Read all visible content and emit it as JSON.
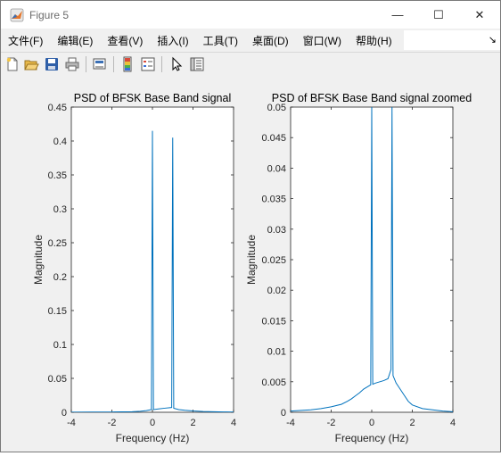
{
  "window": {
    "title": "Figure 5",
    "minimize_glyph": "—",
    "maximize_glyph": "☐",
    "close_glyph": "✕"
  },
  "menu": {
    "items": [
      "文件(F)",
      "编辑(E)",
      "查看(V)",
      "插入(I)",
      "工具(T)",
      "桌面(D)",
      "窗口(W)",
      "帮助(H)"
    ],
    "overflow_glyph": "↘"
  },
  "toolbar": {
    "icons": [
      "new-figure-icon",
      "open-file-icon",
      "save-icon",
      "print-icon",
      "link-plot-icon",
      "insert-colorbar-icon",
      "insert-legend-icon",
      "edit-plot-cursor-icon",
      "property-inspector-icon"
    ]
  },
  "colors": {
    "line": "#0072bd",
    "axes_bg": "#ffffff",
    "figure_bg": "#f0f0f0"
  },
  "chart_data": [
    {
      "type": "line",
      "title": "PSD of BFSK Base Band signal",
      "xlabel": "Frequency (Hz)",
      "ylabel": "Magnitude",
      "xlim": [
        -4,
        4
      ],
      "ylim": [
        0,
        0.45
      ],
      "xticks": [
        "-4",
        "-2",
        "0",
        "2",
        "4"
      ],
      "yticks": [
        "0",
        "0.05",
        "0.1",
        "0.15",
        "0.2",
        "0.25",
        "0.3",
        "0.35",
        "0.4",
        "0.45"
      ],
      "grid": false,
      "series": [
        {
          "x": [
            -4,
            -3,
            -2,
            -1.5,
            -1,
            -0.6,
            -0.3,
            -0.05,
            0,
            0.05,
            0.3,
            0.6,
            0.95,
            1,
            1.05,
            1.3,
            1.6,
            2,
            2.5,
            3,
            3.5,
            4
          ],
          "y": [
            0.0002,
            0.0003,
            0.0004,
            0.0006,
            0.0009,
            0.0015,
            0.0025,
            0.004,
            0.415,
            0.004,
            0.005,
            0.006,
            0.007,
            0.405,
            0.006,
            0.004,
            0.003,
            0.002,
            0.0012,
            0.0008,
            0.0005,
            0.0003
          ]
        }
      ]
    },
    {
      "type": "line",
      "title": "PSD of BFSK Base Band signal zoomed",
      "xlabel": "Frequency (Hz)",
      "ylabel": "Magnitude",
      "xlim": [
        -4,
        4
      ],
      "ylim": [
        0,
        0.05
      ],
      "xticks": [
        "-4",
        "-2",
        "0",
        "2",
        "4"
      ],
      "yticks": [
        "0",
        "0.005",
        "0.01",
        "0.015",
        "0.02",
        "0.025",
        "0.03",
        "0.035",
        "0.04",
        "0.045",
        "0.05"
      ],
      "grid": false,
      "series": [
        {
          "x": [
            -4,
            -3,
            -2.5,
            -2,
            -1.5,
            -1.2,
            -1,
            -0.8,
            -0.6,
            -0.4,
            -0.2,
            -0.05,
            0,
            0.05,
            0.2,
            0.4,
            0.6,
            0.8,
            0.95,
            1,
            1.05,
            1.2,
            1.4,
            1.6,
            1.8,
            2,
            2.5,
            3,
            3.5,
            4
          ],
          "y": [
            0.0002,
            0.0004,
            0.0006,
            0.0009,
            0.0013,
            0.0018,
            0.0022,
            0.0027,
            0.0032,
            0.0038,
            0.0042,
            0.0045,
            0.05,
            0.0046,
            0.0048,
            0.005,
            0.0052,
            0.0055,
            0.007,
            0.05,
            0.006,
            0.0048,
            0.0038,
            0.0028,
            0.0018,
            0.0012,
            0.0006,
            0.0004,
            0.0002,
            0.0001
          ]
        }
      ]
    }
  ]
}
